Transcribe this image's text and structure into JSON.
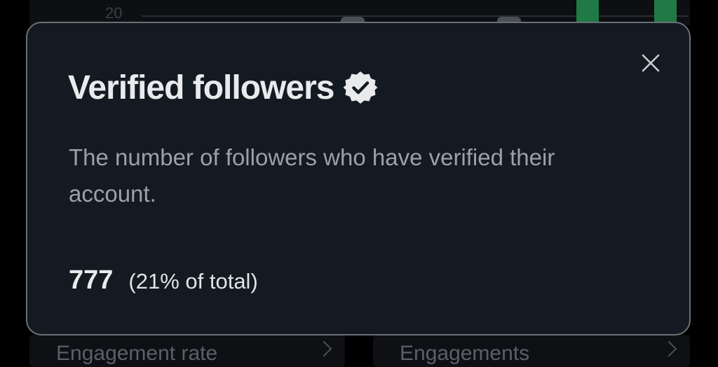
{
  "background": {
    "chart_tick_label": "20",
    "cards": [
      {
        "label": "Engagement rate"
      },
      {
        "label": "Engagements"
      }
    ]
  },
  "modal": {
    "title": "Verified followers",
    "title_icon": "verified-badge-icon",
    "close_icon": "close-icon",
    "description": "The number of followers who have verified their account.",
    "stat_value": "777",
    "stat_percent": "(21% of total)"
  },
  "colors": {
    "modal_background": "#141a21",
    "modal_border": "#6b7075",
    "title_text": "#e8eaec",
    "description_text": "#9aa1a8",
    "chart_bar": "#1f7a45"
  }
}
